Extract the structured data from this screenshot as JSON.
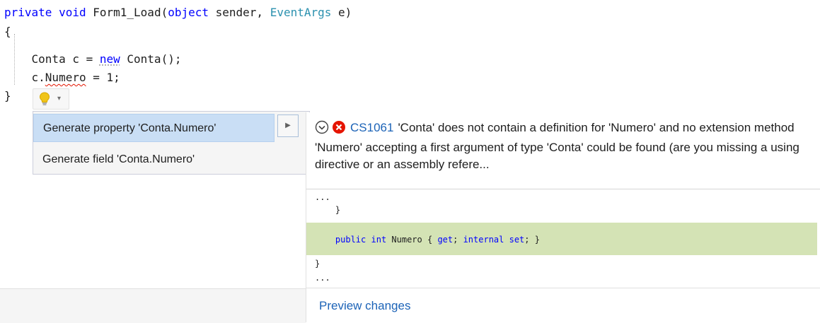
{
  "editor": {
    "line1": {
      "kw1": "private",
      "kw2": "void",
      "method": " Form1_Load(",
      "kw3": "object",
      "p1": " sender, ",
      "type1": "EventArgs",
      "p2": " e)"
    },
    "line2": "{",
    "line3": {
      "indent": "    Conta c = ",
      "kw": "new",
      "rest": " Conta();"
    },
    "line4": {
      "indent": "    c.",
      "member": "Numero",
      "rest": " = 1;"
    },
    "line5": "}"
  },
  "lightbulb": {
    "icon": "lightbulb-icon",
    "dropdown_icon": "chevron-down-icon",
    "bulb_color": "#f0c419"
  },
  "quick_actions": {
    "items": [
      {
        "label": "Generate property 'Conta.Numero'",
        "selected": true
      },
      {
        "label": "Generate field 'Conta.Numero'",
        "selected": false
      }
    ]
  },
  "diagnostic": {
    "code": "CS1061",
    "message": "'Conta' does not contain a definition for 'Numero' and no extension method 'Numero' accepting a first argument of type 'Conta' could be found (are you missing a using directive or an assembly refere...",
    "error_color": "#e51400"
  },
  "preview": {
    "ellipsis_top": "...",
    "close_brace_inner": "    }",
    "added_line": {
      "indent": "    ",
      "kw1": "public",
      "kw2": "int",
      "name": " Numero { ",
      "kw3": "get",
      "mid": "; ",
      "kw4": "internal",
      "kw5": "set",
      "end": "; }"
    },
    "close_brace_outer": "}",
    "ellipsis_bottom": "...",
    "link_label": "Preview changes",
    "added_color": "#d4e3b5"
  }
}
